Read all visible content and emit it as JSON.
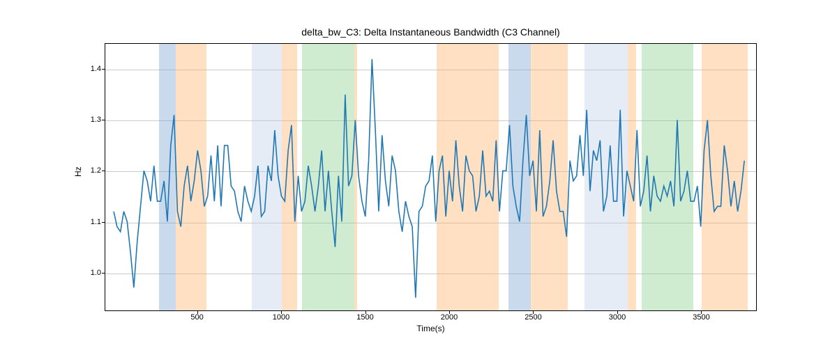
{
  "chart_data": {
    "type": "line",
    "title": "delta_bw_C3: Delta Instantaneous Bandwidth (C3 Channel)",
    "xlabel": "Time(s)",
    "ylabel": "Hz",
    "xlim": [
      -50,
      3830
    ],
    "ylim": [
      0.925,
      1.45
    ],
    "xticks": [
      500,
      1000,
      1500,
      2000,
      2500,
      3000,
      3500
    ],
    "yticks": [
      1.0,
      1.1,
      1.2,
      1.3,
      1.4
    ],
    "bands": [
      {
        "x0": 270,
        "x1": 370,
        "color": "blue"
      },
      {
        "x0": 370,
        "x1": 550,
        "color": "orange"
      },
      {
        "x0": 820,
        "x1": 1000,
        "color": "lightblue"
      },
      {
        "x0": 1000,
        "x1": 1090,
        "color": "orange"
      },
      {
        "x0": 1120,
        "x1": 1430,
        "color": "green"
      },
      {
        "x0": 1430,
        "x1": 1450,
        "color": "orange"
      },
      {
        "x0": 1920,
        "x1": 2290,
        "color": "orange"
      },
      {
        "x0": 2350,
        "x1": 2480,
        "color": "blue"
      },
      {
        "x0": 2480,
        "x1": 2700,
        "color": "orange"
      },
      {
        "x0": 2800,
        "x1": 3060,
        "color": "lightblue"
      },
      {
        "x0": 3060,
        "x1": 3110,
        "color": "orange"
      },
      {
        "x0": 3140,
        "x1": 3450,
        "color": "green"
      },
      {
        "x0": 3500,
        "x1": 3770,
        "color": "orange"
      }
    ],
    "series": [
      {
        "name": "delta_bw_C3",
        "x": [
          0,
          20,
          40,
          60,
          80,
          100,
          120,
          140,
          160,
          180,
          200,
          220,
          240,
          260,
          280,
          300,
          320,
          340,
          360,
          380,
          400,
          420,
          440,
          460,
          480,
          500,
          520,
          540,
          560,
          580,
          600,
          620,
          640,
          660,
          680,
          700,
          720,
          740,
          760,
          780,
          800,
          820,
          840,
          860,
          880,
          900,
          920,
          940,
          960,
          980,
          1000,
          1020,
          1040,
          1060,
          1080,
          1100,
          1120,
          1140,
          1160,
          1180,
          1200,
          1220,
          1240,
          1260,
          1280,
          1300,
          1320,
          1340,
          1360,
          1380,
          1400,
          1420,
          1440,
          1460,
          1480,
          1500,
          1520,
          1540,
          1560,
          1580,
          1600,
          1620,
          1640,
          1660,
          1680,
          1700,
          1720,
          1740,
          1760,
          1780,
          1800,
          1820,
          1840,
          1860,
          1880,
          1900,
          1920,
          1940,
          1960,
          1980,
          2000,
          2020,
          2040,
          2060,
          2080,
          2100,
          2120,
          2140,
          2160,
          2180,
          2200,
          2220,
          2240,
          2260,
          2280,
          2300,
          2320,
          2340,
          2360,
          2380,
          2400,
          2420,
          2440,
          2460,
          2480,
          2500,
          2520,
          2540,
          2560,
          2580,
          2600,
          2620,
          2640,
          2660,
          2680,
          2700,
          2720,
          2740,
          2760,
          2780,
          2800,
          2820,
          2840,
          2860,
          2880,
          2900,
          2920,
          2940,
          2960,
          2980,
          3000,
          3020,
          3040,
          3060,
          3080,
          3100,
          3120,
          3140,
          3160,
          3180,
          3200,
          3220,
          3240,
          3260,
          3280,
          3300,
          3320,
          3340,
          3360,
          3380,
          3400,
          3420,
          3440,
          3460,
          3480,
          3500,
          3520,
          3540,
          3560,
          3580,
          3600,
          3620,
          3640,
          3660,
          3680,
          3700,
          3720,
          3740,
          3760,
          3780
        ],
        "y": [
          1.12,
          1.09,
          1.08,
          1.12,
          1.1,
          1.04,
          0.97,
          1.06,
          1.13,
          1.2,
          1.18,
          1.14,
          1.21,
          1.14,
          1.14,
          1.18,
          1.1,
          1.25,
          1.31,
          1.12,
          1.09,
          1.17,
          1.21,
          1.14,
          1.18,
          1.24,
          1.2,
          1.13,
          1.15,
          1.23,
          1.14,
          1.25,
          1.13,
          1.25,
          1.25,
          1.17,
          1.16,
          1.12,
          1.1,
          1.17,
          1.14,
          1.12,
          1.15,
          1.21,
          1.11,
          1.12,
          1.21,
          1.18,
          1.28,
          1.19,
          1.15,
          1.14,
          1.24,
          1.29,
          1.1,
          1.19,
          1.12,
          1.14,
          1.21,
          1.17,
          1.12,
          1.17,
          1.24,
          1.12,
          1.2,
          1.12,
          1.05,
          1.19,
          1.1,
          1.35,
          1.17,
          1.19,
          1.3,
          1.19,
          1.14,
          1.11,
          1.22,
          1.42,
          1.28,
          1.12,
          1.27,
          1.18,
          1.13,
          1.23,
          1.2,
          1.12,
          1.08,
          1.14,
          1.11,
          1.09,
          0.95,
          1.12,
          1.13,
          1.17,
          1.18,
          1.23,
          1.1,
          1.2,
          1.23,
          1.11,
          1.2,
          1.14,
          1.26,
          1.17,
          1.12,
          1.23,
          1.2,
          1.19,
          1.12,
          1.15,
          1.24,
          1.15,
          1.16,
          1.14,
          1.26,
          1.12,
          1.2,
          1.2,
          1.29,
          1.17,
          1.13,
          1.1,
          1.22,
          1.31,
          1.19,
          1.22,
          1.12,
          1.28,
          1.11,
          1.13,
          1.18,
          1.26,
          1.16,
          1.12,
          1.12,
          1.07,
          1.22,
          1.18,
          1.19,
          1.27,
          1.19,
          1.32,
          1.16,
          1.24,
          1.22,
          1.26,
          1.12,
          1.15,
          1.25,
          1.14,
          1.14,
          1.32,
          1.11,
          1.2,
          1.17,
          1.14,
          1.28,
          1.13,
          1.16,
          1.23,
          1.12,
          1.19,
          1.15,
          1.14,
          1.17,
          1.15,
          1.18,
          1.13,
          1.3,
          1.14,
          1.16,
          1.2,
          1.14,
          1.14,
          1.17,
          1.09,
          1.24,
          1.3,
          1.19,
          1.12,
          1.13,
          1.13,
          1.25,
          1.2,
          1.13,
          1.18,
          1.12,
          1.16,
          1.22
        ]
      }
    ]
  }
}
